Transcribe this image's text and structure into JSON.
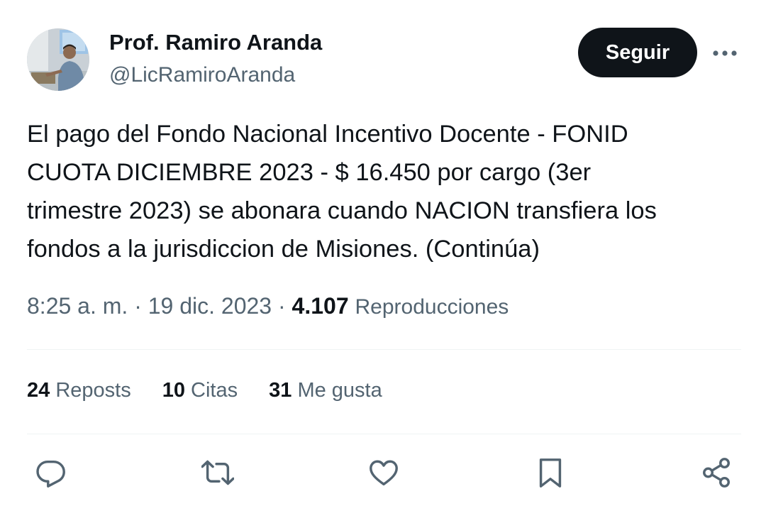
{
  "author": {
    "name": "Prof. Ramiro Aranda",
    "handle": "@LicRamiroAranda"
  },
  "follow_label": "Seguir",
  "tweet": {
    "lines": [
      "El pago del Fondo Nacional Incentivo Docente - FONID",
      "CUOTA DICIEMBRE 2023 - $ 16.450 por cargo (3er",
      "trimestre 2023) se abonara cuando NACION transfiera los",
      "fondos a la jurisdiccion de Misiones. (Continúa)"
    ]
  },
  "meta": {
    "time": "8:25 a. m.",
    "sep1": " · ",
    "date": "19 dic. 2023",
    "sep2": " · ",
    "views_count": "4.107",
    "views_label": "Reproducciones"
  },
  "stats": {
    "reposts_count": "24",
    "reposts_label": "Reposts",
    "quotes_count": "10",
    "quotes_label": "Citas",
    "likes_count": "31",
    "likes_label": "Me gusta"
  },
  "actions": {
    "icons": [
      "reply-icon",
      "repost-icon",
      "like-icon",
      "bookmark-icon",
      "share-icon"
    ],
    "color": "#536471"
  },
  "colors": {
    "text": "#0f1419",
    "secondary": "#536471",
    "divider": "#eff3f4",
    "button_bg": "#0f1419",
    "button_text": "#ffffff"
  }
}
